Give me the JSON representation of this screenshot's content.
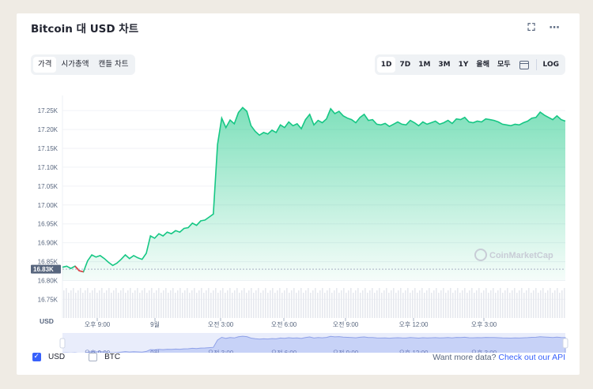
{
  "title": "Bitcoin 대 USD 차트",
  "header_icons": [
    "fullscreen-icon",
    "more-icon"
  ],
  "view_tabs": [
    {
      "label": "가격",
      "active": true
    },
    {
      "label": "시가총액",
      "active": false
    },
    {
      "label": "캔들 차트",
      "active": false
    }
  ],
  "range_tabs": [
    {
      "label": "1D",
      "active": true
    },
    {
      "label": "7D",
      "active": false
    },
    {
      "label": "1M",
      "active": false
    },
    {
      "label": "3M",
      "active": false
    },
    {
      "label": "1Y",
      "active": false
    },
    {
      "label": "올해",
      "active": false
    },
    {
      "label": "모두",
      "active": false
    }
  ],
  "log_label": "LOG",
  "calendar_icon": "calendar-icon",
  "watermark": "CoinMarketCap",
  "chart_data": {
    "type": "area",
    "ylabel_unit": "USD",
    "ylim": [
      16.73,
      17.29
    ],
    "y_ticks": [
      "17.25K",
      "17.20K",
      "17.15K",
      "17.10K",
      "17.05K",
      "17.00K",
      "16.95K",
      "16.90K",
      "16.85K",
      "16.80K",
      "16.75K"
    ],
    "y_tick_values": [
      17.25,
      17.2,
      17.15,
      17.1,
      17.05,
      17.0,
      16.95,
      16.9,
      16.85,
      16.8,
      16.75
    ],
    "x_ticks": [
      "오후 9:00",
      "9월",
      "오전 3:00",
      "오전 6:00",
      "오전 9:00",
      "오후 12:00",
      "오후 3:00"
    ],
    "current_price_label": "16.83K",
    "current_price_value": 16.83,
    "colors": {
      "line": "#16c784",
      "fill": "#16c784",
      "down": "#ea3943",
      "volume": "#cfd6e4",
      "navigator": "#a6b5f0"
    },
    "series": [
      {
        "x_hours": [
          0,
          0.2,
          0.4,
          0.6,
          0.8,
          1.0,
          1.2,
          1.4,
          1.6,
          1.8,
          2.0,
          2.2,
          2.4,
          2.6,
          2.8,
          3.0,
          3.2,
          3.4,
          3.6,
          3.8,
          4.0,
          4.2,
          4.4,
          4.6,
          4.8,
          5.0,
          5.2,
          5.4,
          5.6,
          5.8,
          6.0,
          6.2,
          6.4,
          6.6,
          6.8,
          7.0,
          7.2,
          7.4,
          7.6,
          7.8,
          8.0,
          8.2,
          8.4,
          8.6,
          8.8,
          9.0,
          9.2,
          9.4,
          9.6,
          9.8,
          10.0,
          10.2,
          10.4,
          10.6,
          10.8,
          11.0,
          11.2,
          11.4,
          11.6,
          11.8,
          12.0,
          12.2,
          12.4,
          12.6,
          12.8,
          13.0,
          13.2,
          13.4,
          13.6,
          13.8,
          14.0,
          14.2,
          14.4,
          14.6,
          14.8,
          15.0,
          15.2,
          15.4,
          15.6,
          15.8,
          16.0,
          16.2,
          16.4,
          16.6,
          16.8,
          17.0,
          17.2,
          17.4,
          17.6,
          17.8,
          18.0,
          18.2,
          18.4,
          18.6,
          18.8,
          19.0,
          19.2,
          19.4,
          19.6,
          19.8,
          20.0,
          20.2,
          20.4,
          20.6,
          20.8,
          21.0,
          21.2,
          21.4,
          21.6,
          21.8,
          22.0,
          22.2,
          22.4,
          22.6,
          22.8,
          23.0,
          23.2,
          23.4,
          23.6,
          23.8,
          24.0
        ],
        "values": [
          16.835,
          16.838,
          16.832,
          16.838,
          16.826,
          16.823,
          16.852,
          16.868,
          16.862,
          16.866,
          16.858,
          16.848,
          16.84,
          16.846,
          16.856,
          16.868,
          16.858,
          16.866,
          16.86,
          16.856,
          16.872,
          16.918,
          16.912,
          16.924,
          16.918,
          16.928,
          16.924,
          16.932,
          16.928,
          16.938,
          16.94,
          16.952,
          16.946,
          16.958,
          16.96,
          16.968,
          16.976,
          17.16,
          17.23,
          17.205,
          17.225,
          17.215,
          17.245,
          17.258,
          17.248,
          17.21,
          17.195,
          17.185,
          17.192,
          17.188,
          17.198,
          17.192,
          17.212,
          17.205,
          17.22,
          17.21,
          17.215,
          17.202,
          17.226,
          17.24,
          17.212,
          17.224,
          17.218,
          17.228,
          17.255,
          17.242,
          17.248,
          17.236,
          17.23,
          17.226,
          17.218,
          17.232,
          17.24,
          17.224,
          17.226,
          17.214,
          17.212,
          17.216,
          17.208,
          17.214,
          17.22,
          17.214,
          17.212,
          17.224,
          17.218,
          17.21,
          17.22,
          17.214,
          17.218,
          17.222,
          17.214,
          17.218,
          17.224,
          17.216,
          17.228,
          17.226,
          17.232,
          17.22,
          17.218,
          17.222,
          17.22,
          17.228,
          17.226,
          17.224,
          17.22,
          17.214,
          17.212,
          17.21,
          17.214,
          17.212,
          17.218,
          17.222,
          17.23,
          17.232,
          17.246,
          17.238,
          17.232,
          17.226,
          17.236,
          17.226,
          17.222
        ]
      }
    ]
  },
  "footer": {
    "currencies": [
      {
        "label": "USD",
        "checked": true
      },
      {
        "label": "BTC",
        "checked": false
      }
    ],
    "want_more": "Want more data?",
    "api_link": "Check out our API"
  }
}
